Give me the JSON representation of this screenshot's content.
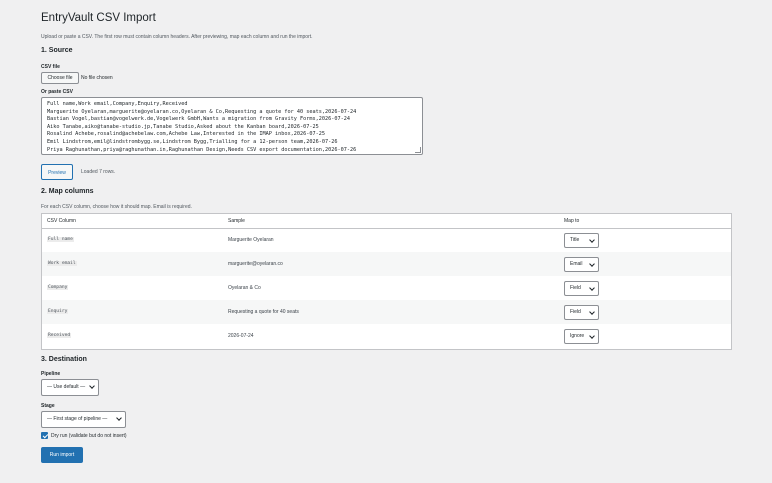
{
  "page": {
    "title": "EntryVault CSV Import",
    "description": "Upload or paste a CSV. The first row must contain column headers. After previewing, map each column and run the import."
  },
  "source": {
    "heading": "1. Source",
    "file_label": "CSV file",
    "file_button": "Choose file",
    "file_status": "No file chosen",
    "paste_label": "Or paste CSV",
    "csv_lines": [
      "Full name,Work email,Company,Enquiry,Received",
      "Marguerite Oyelaran,marguerite@oyelaran.co,Oyelaran & Co,Requesting a quote for 40 seats,2026-07-24",
      "Bastian Vogel,bastian@vogelwerk.de,Vogelwerk GmbH,Wants a migration from Gravity Forms,2026-07-24",
      "Aiko Tanabe,aiko@tanabe-studio.jp,Tanabe Studio,Asked about the Kanban board,2026-07-25",
      "Rosalind Achebe,rosalind@achebelaw.com,Achebe Law,Interested in the IMAP inbox,2026-07-25",
      "Emil Lindstrom,emil@lindstrombygg.se,Lindstrom Bygg,Trialling for a 12-person team,2026-07-26",
      "Priya Raghunathan,priya@raghunathan.in,Raghunathan Design,Needs CSV export documentation,2026-07-26"
    ],
    "preview_button": "Preview",
    "preview_status": "Loaded 7 rows."
  },
  "mapping": {
    "heading": "2. Map columns",
    "description": "For each CSV column, choose how it should map. Email is required.",
    "headers": {
      "column": "CSV Column",
      "sample": "Sample",
      "map_to": "Map to"
    },
    "rows": [
      {
        "column": "Full name",
        "sample": "Marguerite Oyelaran",
        "map_to": "Title"
      },
      {
        "column": "Work email",
        "sample": "marguerite@oyelaran.co",
        "map_to": "Email"
      },
      {
        "column": "Company",
        "sample": "Oyelaran & Co",
        "map_to": "Field"
      },
      {
        "column": "Enquiry",
        "sample": "Requesting a quote for 40 seats",
        "map_to": "Field"
      },
      {
        "column": "Received",
        "sample": "2026-07-24",
        "map_to": "Ignore"
      }
    ]
  },
  "destination": {
    "heading": "3. Destination",
    "pipeline_label": "Pipeline",
    "pipeline_value": "— Use default —",
    "stage_label": "Stage",
    "stage_value": "— First stage of pipeline —",
    "dry_run_label": "Dry run (validate but do not insert)",
    "run_button": "Run import"
  }
}
